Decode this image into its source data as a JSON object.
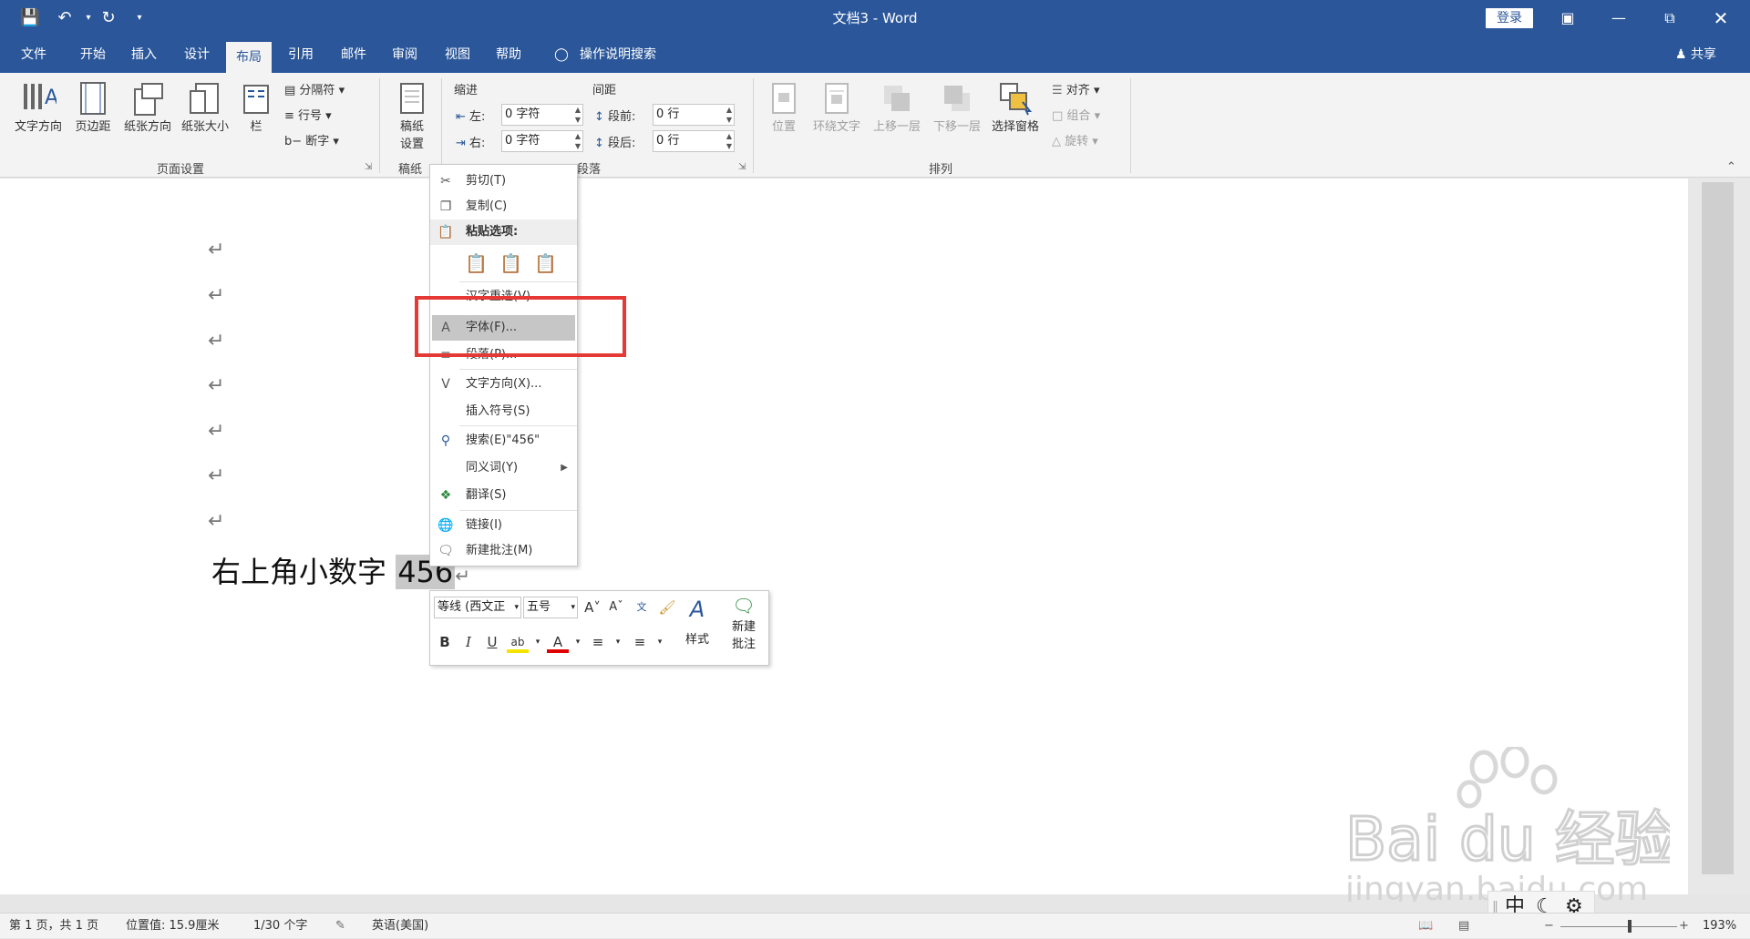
{
  "title_bar": {
    "doc_title": "文档3  -  Word",
    "login_label": "登录"
  },
  "menu_tabs": [
    "文件",
    "开始",
    "插入",
    "设计",
    "布局",
    "引用",
    "邮件",
    "审阅",
    "视图",
    "帮助"
  ],
  "active_tab": "布局",
  "tell_me": "操作说明搜索",
  "share_label": "共享",
  "ribbon": {
    "page_setup": {
      "buttons": [
        "文字方向",
        "页边距",
        "纸张方向",
        "纸张大小",
        "栏"
      ],
      "small": [
        "分隔符",
        "行号",
        "断字"
      ],
      "label": "页面设置"
    },
    "manuscript": {
      "button_line1": "稿纸",
      "button_line2": "设置",
      "label": "稿纸"
    },
    "paragraph": {
      "indent_label": "缩进",
      "spacing_label": "间距",
      "left_label": "左:",
      "right_label": "右:",
      "before_label": "段前:",
      "after_label": "段后:",
      "left_value": "0 字符",
      "right_value": "0 字符",
      "before_value": "0 行",
      "after_value": "0 行",
      "label": "段落"
    },
    "arrange": {
      "buttons": [
        "位置",
        "环绕文字",
        "上移一层",
        "下移一层",
        "选择窗格"
      ],
      "small": [
        "对齐",
        "组合",
        "旋转"
      ],
      "label": "排列"
    }
  },
  "document": {
    "text": "右上角小数字 ",
    "selected": "456"
  },
  "context_menu": {
    "cut": "剪切(T)",
    "copy": "复制(C)",
    "paste_options": "粘贴选项:",
    "reconvert": "汉字重选(V)",
    "font": "字体(F)...",
    "paragraph": "段落(P)...",
    "text_direction": "文字方向(X)...",
    "insert_symbol": "插入符号(S)",
    "search": "搜索(E)\"456\"",
    "synonyms": "同义词(Y)",
    "translate": "翻译(S)",
    "link": "链接(I)",
    "new_comment": "新建批注(M)"
  },
  "mini_toolbar": {
    "font_name": "等线 (西文正",
    "font_size": "五号",
    "styles_label": "样式",
    "new_comment_line1": "新建",
    "new_comment_line2": "批注"
  },
  "status_bar": {
    "page": "第 1 页，共 1 页",
    "position": "位置值: 15.9厘米",
    "words": "1/30 个字",
    "language": "英语(美国)",
    "zoom": "193%"
  },
  "ime": {
    "mode": "中"
  },
  "watermark": {
    "line1": "Bai du 经验",
    "line2": "jingyan.baidu.com"
  },
  "colors": {
    "brand": "#2b579a",
    "highlight_box": "#e53935",
    "selection": "#c8c8c8"
  }
}
